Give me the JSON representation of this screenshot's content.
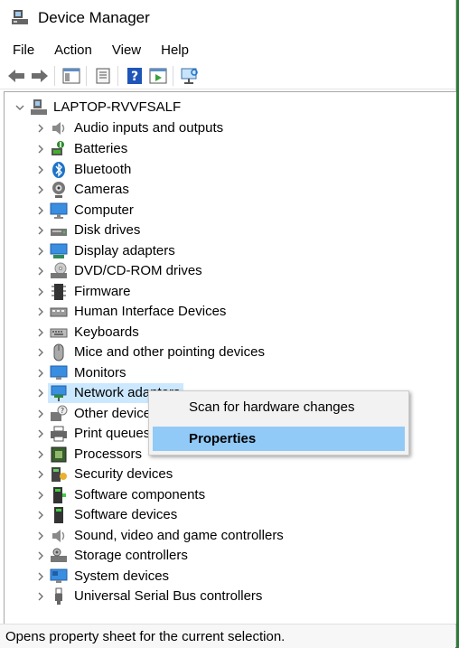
{
  "window": {
    "title": "Device Manager"
  },
  "menu": [
    "File",
    "Action",
    "View",
    "Help"
  ],
  "toolbar": {
    "buttons": [
      "back-arrow-icon",
      "forward-arrow-icon",
      "show-hide-console-tree-icon",
      "properties-sheet-icon",
      "help-icon",
      "run-action-icon",
      "scan-hardware-icon"
    ]
  },
  "tree": {
    "root": "LAPTOP-RVVFSALF",
    "categories": [
      "Audio inputs and outputs",
      "Batteries",
      "Bluetooth",
      "Cameras",
      "Computer",
      "Disk drives",
      "Display adapters",
      "DVD/CD-ROM drives",
      "Firmware",
      "Human Interface Devices",
      "Keyboards",
      "Mice and other pointing devices",
      "Monitors",
      "Network adapters",
      "Other devices",
      "Print queues",
      "Processors",
      "Security devices",
      "Software components",
      "Software devices",
      "Sound, video and game controllers",
      "Storage controllers",
      "System devices",
      "Universal Serial Bus controllers"
    ],
    "selected": "Network adapters"
  },
  "context_menu": {
    "items": [
      "Scan for hardware changes",
      "Properties"
    ],
    "highlighted": "Properties"
  },
  "status": "Opens property sheet for the current selection.",
  "colors": {
    "selection": "#cce8ff",
    "menu_highlight": "#91c9f7",
    "accent": "#1e73c8"
  }
}
